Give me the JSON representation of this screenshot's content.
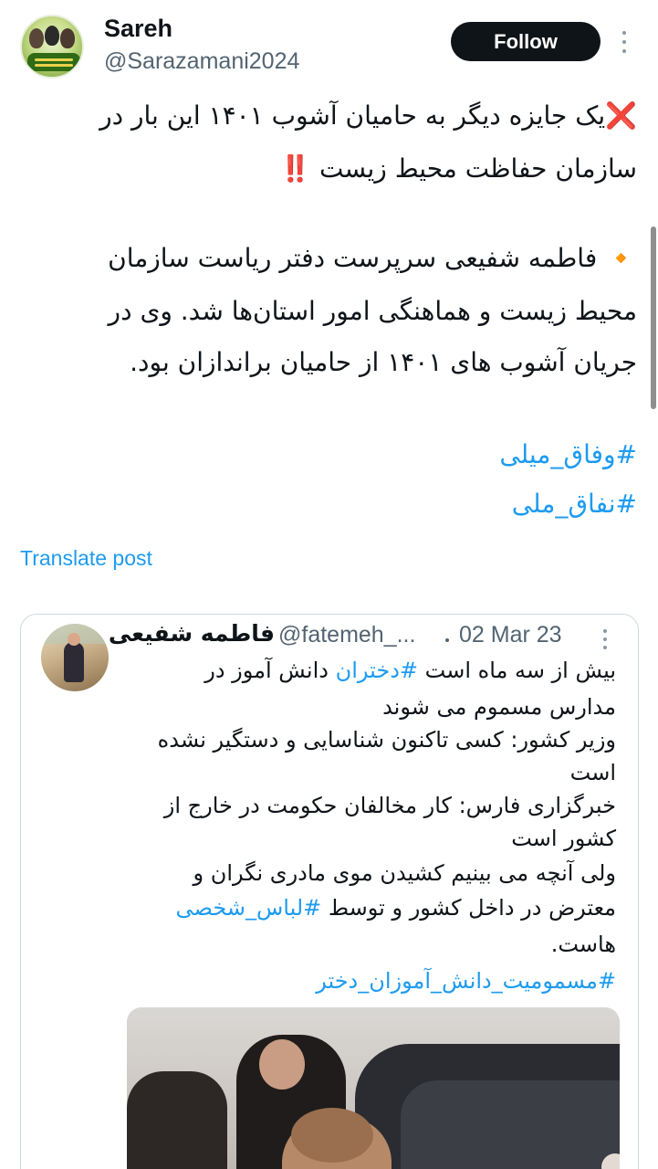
{
  "author": {
    "name": "Sareh",
    "handle": "@Sarazamani2024",
    "follow_label": "Follow"
  },
  "tweet": {
    "icon_x": "❌",
    "line1": "یک جایزه دیگر به حامیان آشوب ۱۴۰۱ این بار در",
    "line2": "سازمان حفاظت محیط زیست",
    "icon_bang": "‼️",
    "bullet_icon": "🔸",
    "para_line1": "فاطمه شفیعی سرپرست دفتر ریاست سازمان",
    "para_line2": "محیط زیست و هماهنگی امور استان‌ها شد. وی در",
    "para_line3": "جریان آشوب های ۱۴۰۱ از حامیان براندازان بود.",
    "hashtags": [
      "#وفاق_میلی",
      "#نفاق_ملی"
    ],
    "translate_label": "Translate post"
  },
  "quoted": {
    "name": "فاطمه شفیعی",
    "handle": "@fatemeh_...",
    "date": "02 Mar 23",
    "line1_pre": "بیش از سه ماه است",
    "line1_tag": "#دختران",
    "line1_post": "دانش آموز در",
    "line2": "مدارس مسموم می شوند",
    "line3": "وزیر کشور: کسی تاکنون شناسایی و دستگیر نشده",
    "line4": "است",
    "line5": "خبرگزاری فارس: کار مخالفان حکومت در خارج از",
    "line6": "کشور است",
    "line7": "ولی آنچه می بینیم کشیدن موی مادری نگران و",
    "line8_pre": "معترض در داخل کشور و توسط",
    "line8_tag": "#لباس_شخصی",
    "line9": "هاست.",
    "line10_tag": "#مسمومیت_دانش_آموزان_دختر"
  },
  "colors": {
    "accent": "#1d9bf0",
    "text": "#0f1419",
    "muted": "#536471",
    "follow_bg": "#0f1419"
  }
}
